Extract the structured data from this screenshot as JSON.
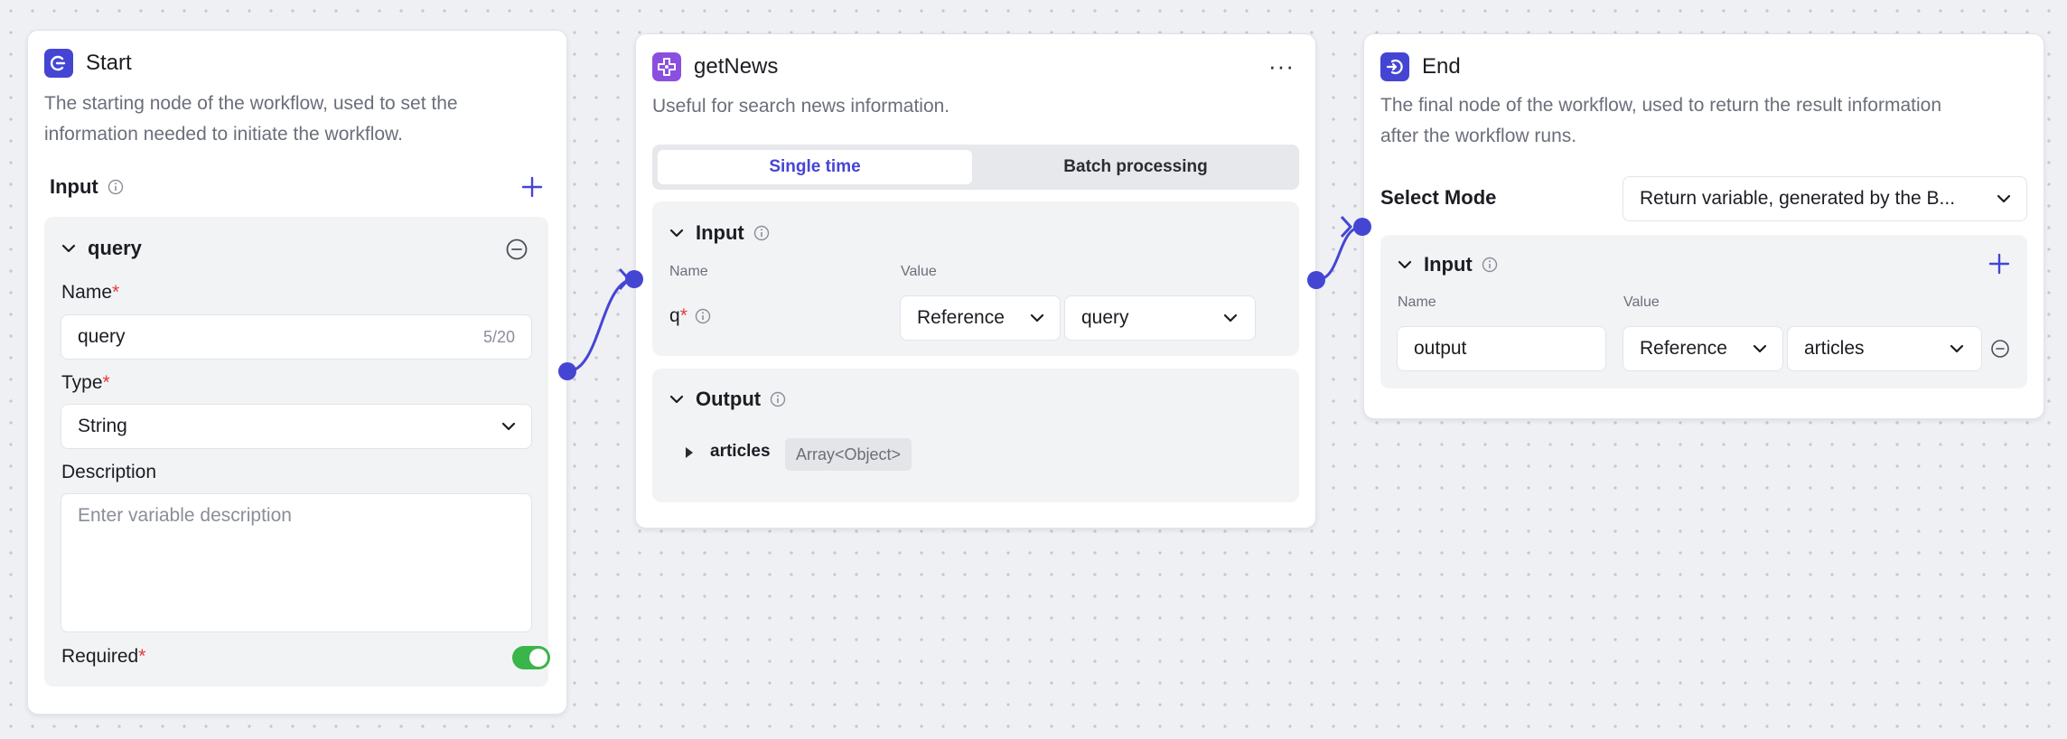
{
  "start_node": {
    "title": "Start",
    "description_line1": "The starting node of the workflow, used to set the",
    "description_line2": "information needed to initiate the workflow.",
    "input_label": "Input",
    "variable": {
      "name": "query",
      "name_label": "Name",
      "name_value": "query",
      "name_counter": "5/20",
      "type_label": "Type",
      "type_value": "String",
      "description_label": "Description",
      "description_placeholder": "Enter variable description",
      "required_label": "Required",
      "required_on": true
    },
    "icon": "start-icon"
  },
  "getnews_node": {
    "title": "getNews",
    "description": "Useful for search news information.",
    "tabs": [
      "Single time",
      "Batch processing"
    ],
    "active_tab": 0,
    "input_label": "Input",
    "col_name": "Name",
    "col_value": "Value",
    "param_name": "q",
    "param_source": "Reference",
    "param_value": "query",
    "output_label": "Output",
    "output_field": "articles",
    "output_type": "Array<Object>",
    "icon": "plugin-icon"
  },
  "end_node": {
    "title": "End",
    "description_line1": "The final node of the workflow, used to return the result information",
    "description_line2": "after the workflow runs.",
    "select_mode_label": "Select Mode",
    "select_mode_value": "Return variable, generated by the B...",
    "input_label": "Input",
    "col_name": "Name",
    "col_value": "Value",
    "var_name": "output",
    "var_source": "Reference",
    "var_value": "articles",
    "icon": "end-icon"
  },
  "colors": {
    "accent": "#4545d4",
    "toggle_on": "#3ab54a",
    "required": "#e23b3b",
    "plugin": "#8b4fe0"
  }
}
